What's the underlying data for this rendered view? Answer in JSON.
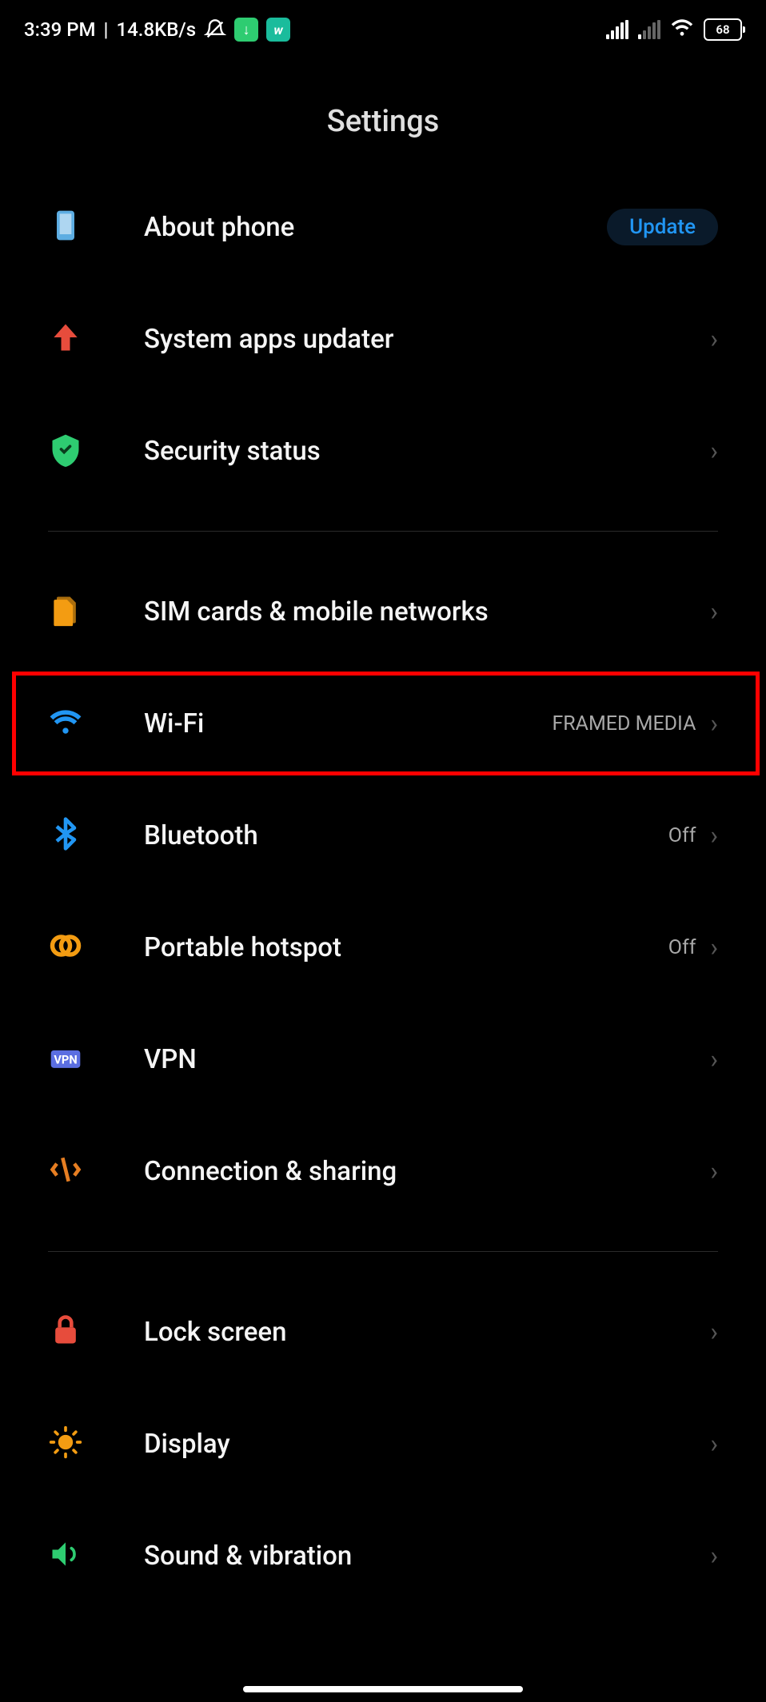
{
  "status_bar": {
    "time": "3:39 PM",
    "speed": "14.8KB/s",
    "battery": "68"
  },
  "page_title": "Settings",
  "items": {
    "about_phone": {
      "label": "About phone",
      "badge": "Update"
    },
    "system_updater": {
      "label": "System apps updater"
    },
    "security": {
      "label": "Security status"
    },
    "sim": {
      "label": "SIM cards & mobile networks"
    },
    "wifi": {
      "label": "Wi-Fi",
      "value": "FRAMED MEDIA"
    },
    "bluetooth": {
      "label": "Bluetooth",
      "value": "Off"
    },
    "hotspot": {
      "label": "Portable hotspot",
      "value": "Off"
    },
    "vpn": {
      "label": "VPN"
    },
    "connection": {
      "label": "Connection & sharing"
    },
    "lock": {
      "label": "Lock screen"
    },
    "display": {
      "label": "Display"
    },
    "sound": {
      "label": "Sound & vibration"
    }
  }
}
